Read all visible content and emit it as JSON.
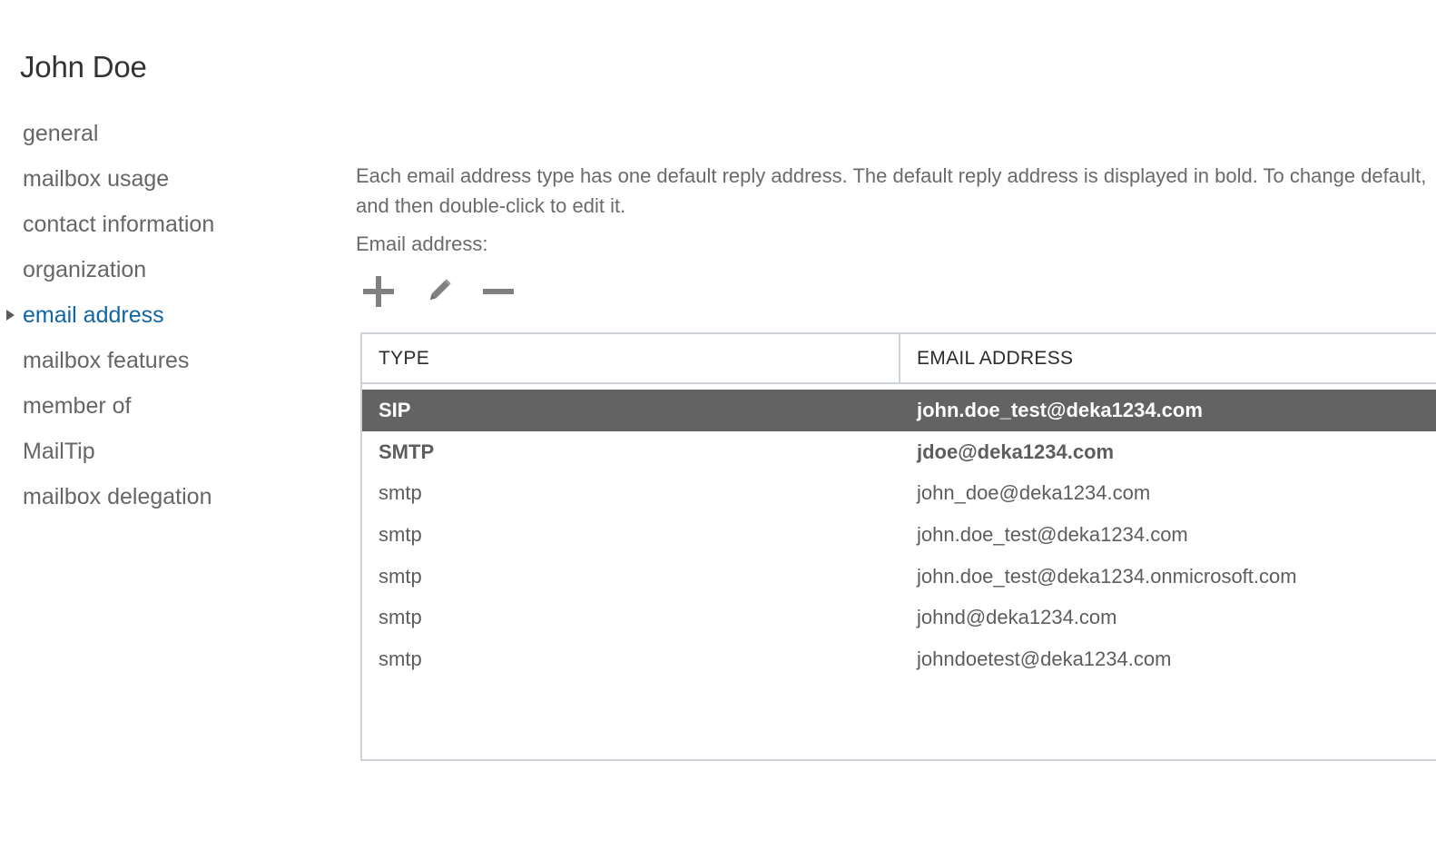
{
  "page_title": "John Doe",
  "sidebar": {
    "items": [
      {
        "label": "general",
        "selected": false
      },
      {
        "label": "mailbox usage",
        "selected": false
      },
      {
        "label": "contact information",
        "selected": false
      },
      {
        "label": "organization",
        "selected": false
      },
      {
        "label": "email address",
        "selected": true
      },
      {
        "label": "mailbox features",
        "selected": false
      },
      {
        "label": "member of",
        "selected": false
      },
      {
        "label": "MailTip",
        "selected": false
      },
      {
        "label": "mailbox delegation",
        "selected": false
      }
    ]
  },
  "main": {
    "intro_text": "Each email address type has one default reply address. The default reply address is displayed in bold. To change default, and then double-click to edit it.",
    "field_label": "Email address:",
    "toolbar": [
      {
        "icon": "plus-icon",
        "name": "add-email-address-button"
      },
      {
        "icon": "pencil-icon",
        "name": "edit-email-address-button"
      },
      {
        "icon": "minus-icon",
        "name": "remove-email-address-button"
      }
    ],
    "table": {
      "columns": [
        "TYPE",
        "EMAIL ADDRESS"
      ],
      "rows": [
        {
          "type": "SIP",
          "address": "john.doe_test@deka1234.com",
          "selected": true,
          "bold": true
        },
        {
          "type": "SMTP",
          "address": "jdoe@deka1234.com",
          "selected": false,
          "bold": true
        },
        {
          "type": "smtp",
          "address": "john_doe@deka1234.com",
          "selected": false,
          "bold": false
        },
        {
          "type": "smtp",
          "address": "john.doe_test@deka1234.com",
          "selected": false,
          "bold": false
        },
        {
          "type": "smtp",
          "address": "john.doe_test@deka1234.onmicrosoft.com",
          "selected": false,
          "bold": false
        },
        {
          "type": "smtp",
          "address": "johnd@deka1234.com",
          "selected": false,
          "bold": false
        },
        {
          "type": "smtp",
          "address": "johndoetest@deka1234.com",
          "selected": false,
          "bold": false
        }
      ]
    }
  },
  "colors": {
    "accent": "#1266a8",
    "selected_row_bg": "#636363",
    "text": "#666666",
    "title": "#333333",
    "border": "#cdd3d8",
    "icon": "#808080"
  }
}
